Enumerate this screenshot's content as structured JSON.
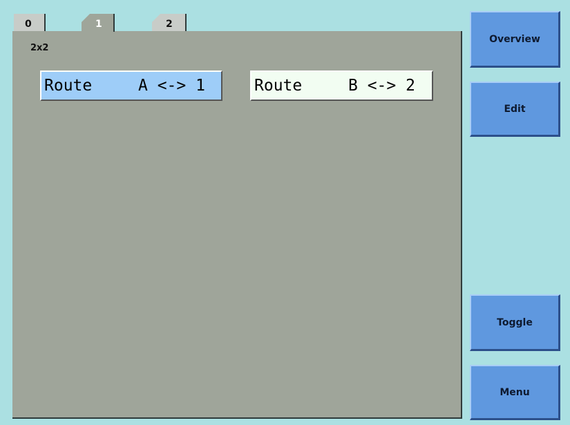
{
  "tabs": [
    {
      "label": "0"
    },
    {
      "label": "1"
    },
    {
      "label": "2"
    }
  ],
  "panel": {
    "title": "2x2",
    "routes": [
      {
        "label": "Route",
        "value": "A <-> 1"
      },
      {
        "label": "Route",
        "value": "B <-> 2"
      }
    ]
  },
  "side_buttons": {
    "overview": "Overview",
    "edit": "Edit",
    "toggle": "Toggle",
    "menu": "Menu"
  },
  "colors": {
    "background": "#abe0e2",
    "panel": "#9fa59a",
    "button": "#5f98df",
    "route_selected": "#9ecdf8",
    "route_unselected": "#f2fdf2"
  }
}
